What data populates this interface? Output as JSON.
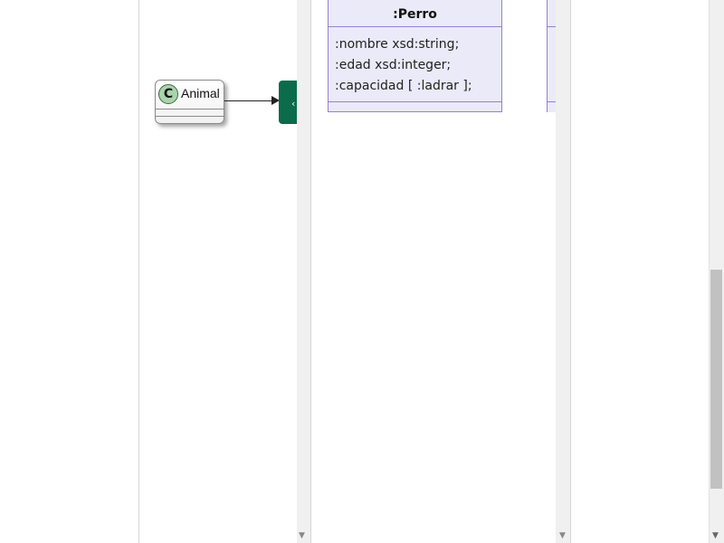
{
  "left_diagram": {
    "class_stereotype": "C",
    "class_name": "Animal"
  },
  "middle_diagram": {
    "class_title": ":Perro",
    "attributes": [
      ":nombre xsd:string;",
      ":edad xsd:integer;",
      ":capacidad [ :ladrar ];"
    ]
  },
  "scrollbars": {
    "down_arrow": "▼"
  },
  "colors": {
    "uml_class_bg": "#eaeaf8",
    "uml_class_border": "#9a7ed0",
    "green_node": "#0b6b4b",
    "stereotype_circle": "#a9d4aa"
  }
}
